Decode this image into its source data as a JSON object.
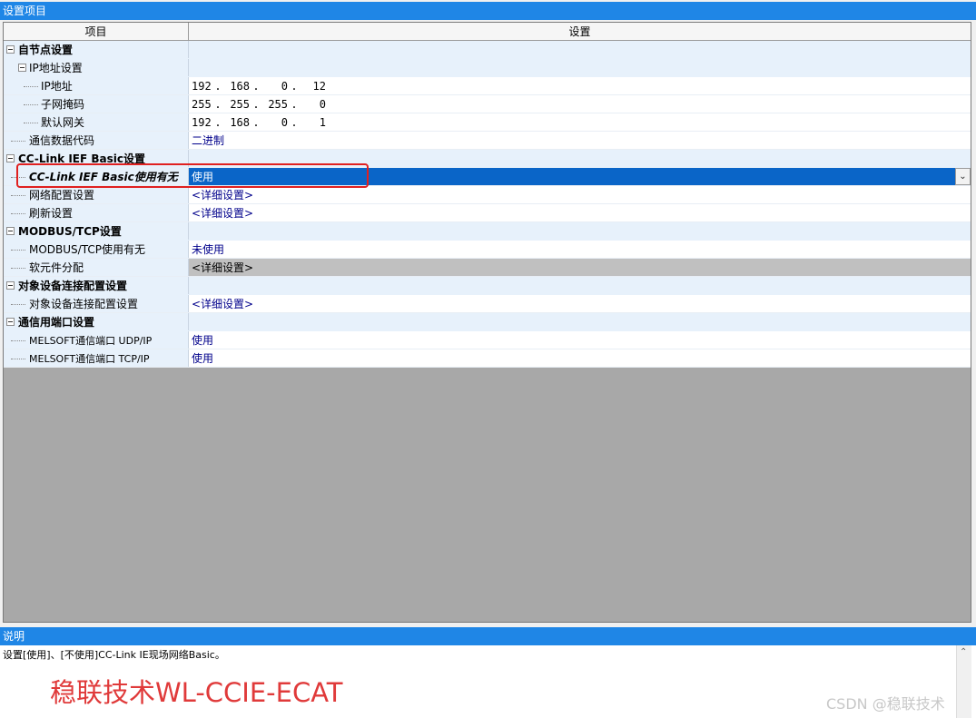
{
  "top_title": "设置项目",
  "columns": {
    "item": "项目",
    "setting": "设置"
  },
  "rows": [
    {
      "label": "自节点设置",
      "value": ""
    },
    {
      "label": "IP地址设置",
      "value": ""
    },
    {
      "label": "IP地址",
      "ip": [
        "192",
        "168",
        "0",
        "12"
      ]
    },
    {
      "label": "子网掩码",
      "ip": [
        "255",
        "255",
        "255",
        "0"
      ]
    },
    {
      "label": "默认网关",
      "ip": [
        "192",
        "168",
        "0",
        "1"
      ]
    },
    {
      "label": "通信数据代码",
      "value": "二进制"
    },
    {
      "label": "CC-Link IEF Basic设置",
      "value": ""
    },
    {
      "label": "CC-Link IEF Basic使用有无",
      "value": "使用"
    },
    {
      "label": "网络配置设置",
      "value": "<详细设置>"
    },
    {
      "label": "刷新设置",
      "value": "<详细设置>"
    },
    {
      "label": "MODBUS/TCP设置",
      "value": ""
    },
    {
      "label": "MODBUS/TCP使用有无",
      "value": "未使用"
    },
    {
      "label": "软元件分配",
      "value": "<详细设置>"
    },
    {
      "label": "对象设备连接配置设置",
      "value": ""
    },
    {
      "label": "对象设备连接配置设置",
      "value": "<详细设置>"
    },
    {
      "label": "通信用端口设置",
      "value": ""
    },
    {
      "label": "MELSOFT通信端口 UDP/IP",
      "value": "使用"
    },
    {
      "label": "MELSOFT通信端口 TCP/IP",
      "value": "使用"
    }
  ],
  "bottom_title": "说明",
  "description": "设置[使用]、[不使用]CC-Link IE现场网络Basic。",
  "watermark": "稳联技术WL-CCIE-ECAT",
  "csdn_watermark": "CSDN @稳联技术",
  "icons": {
    "collapse": "minus-box-icon",
    "dropdown": "chevron-down-icon",
    "scroll_up": "scroll-up-icon"
  },
  "colors": {
    "title_bar": "#1f86e6",
    "selected_row": "#0a65c8",
    "highlight_box": "#e02020",
    "watermark": "#e03a3a"
  }
}
